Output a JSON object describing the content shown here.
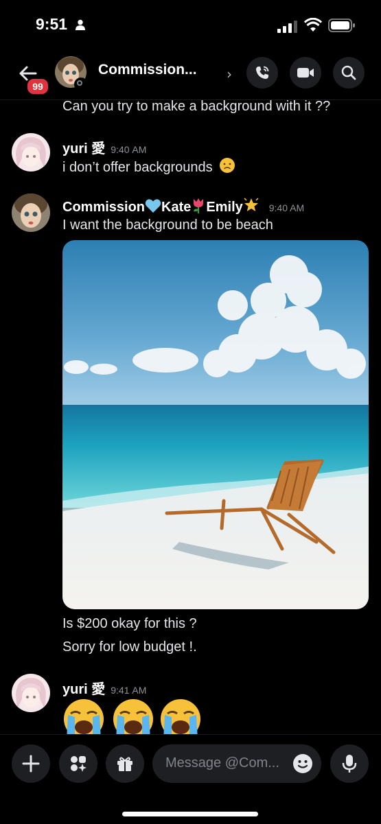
{
  "status_bar": {
    "time": "9:51"
  },
  "header": {
    "unread_badge": "99",
    "title": "Commission...",
    "chevron": "›"
  },
  "messages": {
    "cut_off_line": "Can you try to make a background with it ??",
    "m1": {
      "author": "yuri 愛",
      "time": "9:40 AM",
      "text": "i don’t offer backgrounds"
    },
    "m2": {
      "author_parts": [
        "Commission",
        "Kate",
        "Emily"
      ],
      "time": "9:40 AM",
      "text": "I want the background to be beach",
      "after_image": [
        "Is $200 okay for this ?",
        "Sorry for low budget !."
      ]
    },
    "m3": {
      "author": "yuri 愛",
      "time": "9:41 AM"
    }
  },
  "composer": {
    "placeholder": "Message @Com..."
  },
  "colors": {
    "accent_badge": "#e0333f",
    "button_bg": "#1e1f22",
    "background": "#000000"
  }
}
